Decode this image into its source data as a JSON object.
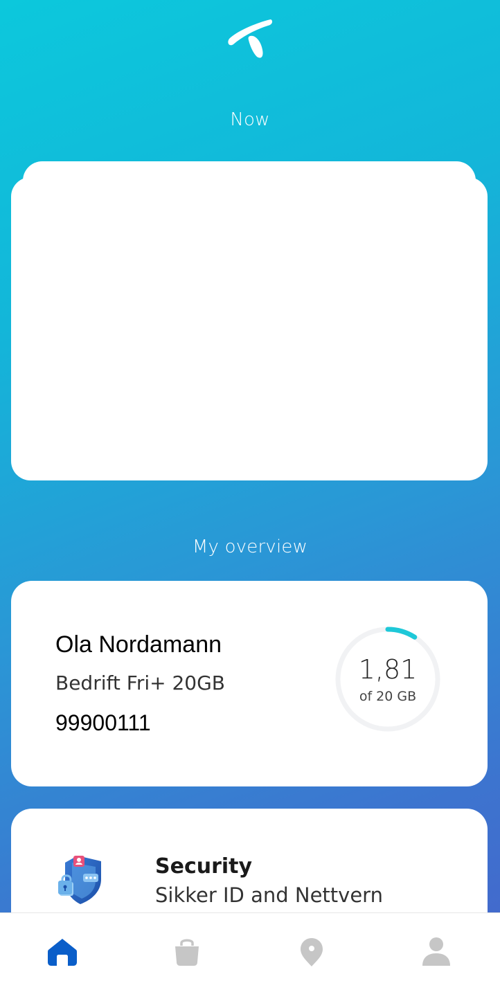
{
  "colors": {
    "brand_gradient_start": "#0cc8dc",
    "brand_gradient_end": "#4565cb",
    "ring_progress": "#1ec8d8",
    "ring_track": "#f1f2f4",
    "nav_active": "#0a5ec9",
    "nav_inactive": "#c6c6c6"
  },
  "header": {
    "logo_icon": "telenor-logo-icon"
  },
  "now_section": {
    "title": "Now"
  },
  "overview_section": {
    "title": "My overview"
  },
  "subscription": {
    "name": "Ola Nordamann",
    "plan": "Bedrift Fri+ 20GB",
    "number": "99900111",
    "usage_value": "1,81",
    "usage_limit": "of 20 GB",
    "usage_fraction": 0.0905
  },
  "security": {
    "icon": "shield-lock-icon",
    "title": "Security",
    "subtitle": "Sikker ID and Nettvern"
  },
  "bottom_nav": {
    "items": [
      {
        "icon": "home-icon",
        "active": true
      },
      {
        "icon": "shopping-bag-icon",
        "active": false
      },
      {
        "icon": "map-pin-icon",
        "active": false
      },
      {
        "icon": "profile-icon",
        "active": false
      }
    ]
  }
}
